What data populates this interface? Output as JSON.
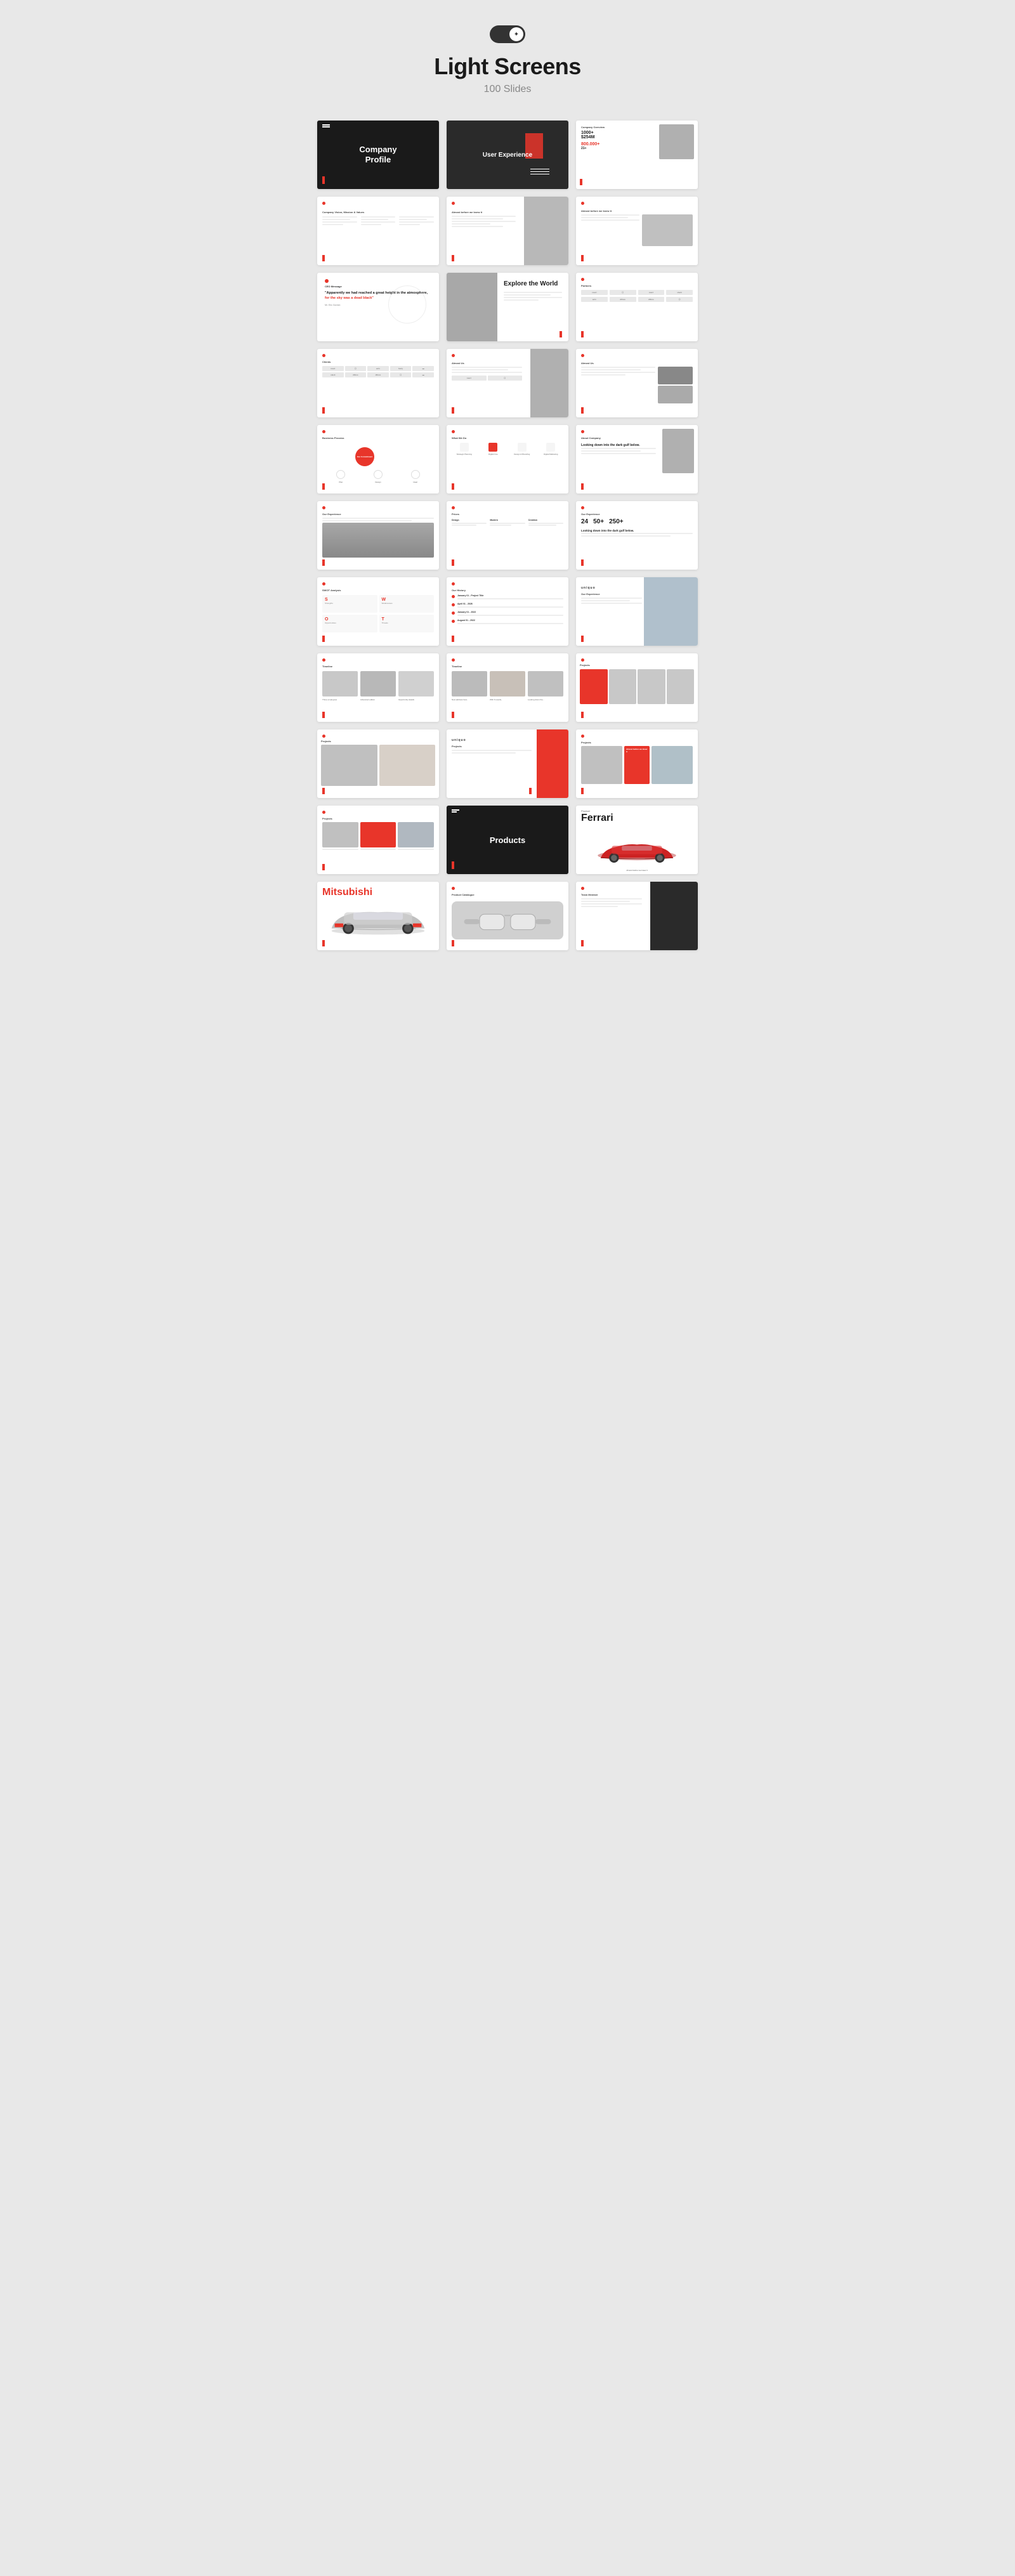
{
  "header": {
    "title": "Light Screens",
    "subtitle": "100 Slides",
    "toggle_label": "Theme toggle"
  },
  "slides": [
    {
      "id": 1,
      "type": "dark-title",
      "title": "Company Profile",
      "label": "company-profile"
    },
    {
      "id": 2,
      "type": "dark-ux",
      "title": "User Experience",
      "label": "user-experience"
    },
    {
      "id": 3,
      "type": "overview",
      "title": "Company Overview",
      "stats": [
        "1000+",
        "$254M",
        "800,000+",
        "21+"
      ]
    },
    {
      "id": 4,
      "type": "light-text",
      "title": "Company Vision, Mission & Values",
      "label": "vision-mission"
    },
    {
      "id": 5,
      "type": "light-photo",
      "title": "Almost before we knew it",
      "label": "slide-5"
    },
    {
      "id": 6,
      "type": "light-photo",
      "title": "Almost before we knew it",
      "label": "slide-6"
    },
    {
      "id": 7,
      "type": "ceo-message",
      "title": "CEO Message",
      "quote": "\"Apparently we had reached a great height in the atmosphere, for the sky was a dead black\"",
      "name": "Mr. Eric Gordon"
    },
    {
      "id": 8,
      "type": "explore-world",
      "title": "Explore the World",
      "label": "explore"
    },
    {
      "id": 9,
      "type": "partners",
      "title": "Partners",
      "label": "partners"
    },
    {
      "id": 10,
      "type": "clients",
      "title": "Clients",
      "label": "clients"
    },
    {
      "id": 11,
      "type": "clients2",
      "title": "Clients",
      "label": "clients2"
    },
    {
      "id": 12,
      "type": "about-text",
      "title": "Almost Us",
      "label": "about"
    },
    {
      "id": 13,
      "type": "process",
      "title": "Business Process",
      "label": "process"
    },
    {
      "id": 14,
      "type": "whatwedo",
      "title": "What We Do",
      "label": "whatwedo"
    },
    {
      "id": 15,
      "type": "about-company",
      "title": "About Company",
      "label": "about-company"
    },
    {
      "id": 16,
      "type": "exp-photo",
      "title": "Our Experience",
      "label": "exp-photo"
    },
    {
      "id": 17,
      "type": "prices",
      "title": "Prices",
      "label": "prices"
    },
    {
      "id": 18,
      "type": "exp-stats",
      "title": "Our Experience",
      "stats": [
        "24",
        "50+",
        "250+"
      ]
    },
    {
      "id": 19,
      "type": "swot",
      "title": "SWOT Analysis",
      "letters": [
        "S",
        "W",
        "O",
        "T"
      ],
      "labels": [
        "Strengths",
        "Weaknesses",
        "Opportunities",
        "Threats"
      ]
    },
    {
      "id": 20,
      "type": "our-history",
      "title": "Our History",
      "label": "our-history"
    },
    {
      "id": 21,
      "type": "hist-photo",
      "title": "Our Experience",
      "label": "hist-photo"
    },
    {
      "id": 22,
      "type": "timeline",
      "title": "Timeline",
      "label": "timeline"
    },
    {
      "id": 23,
      "type": "timeline2",
      "title": "Timeline",
      "label": "timeline2"
    },
    {
      "id": 24,
      "type": "projects-4col",
      "title": "Projects",
      "label": "projects-4col"
    },
    {
      "id": 25,
      "type": "proj-2col",
      "title": "Projects",
      "label": "proj-2col"
    },
    {
      "id": 26,
      "type": "proj-red-col",
      "title": "Projects",
      "label": "proj-red-col"
    },
    {
      "id": 27,
      "type": "proj-red2",
      "title": "Projects",
      "label": "proj-red2"
    },
    {
      "id": 28,
      "type": "proj-cards",
      "title": "Projects",
      "label": "proj-cards"
    },
    {
      "id": 29,
      "type": "products-dark",
      "title": "Products",
      "label": "products-dark"
    },
    {
      "id": 30,
      "type": "ferrari",
      "title": "Ferrari",
      "product_label": "Product",
      "caption": "Almost before we knew it"
    },
    {
      "id": 31,
      "type": "mitsubishi",
      "title": "Mitsubishi",
      "label": "mitsubishi"
    },
    {
      "id": 32,
      "type": "vr",
      "title": "Product Catalogue",
      "label": "vr"
    },
    {
      "id": 33,
      "type": "last-slide",
      "title": "Team Member",
      "label": "last-slide"
    }
  ]
}
